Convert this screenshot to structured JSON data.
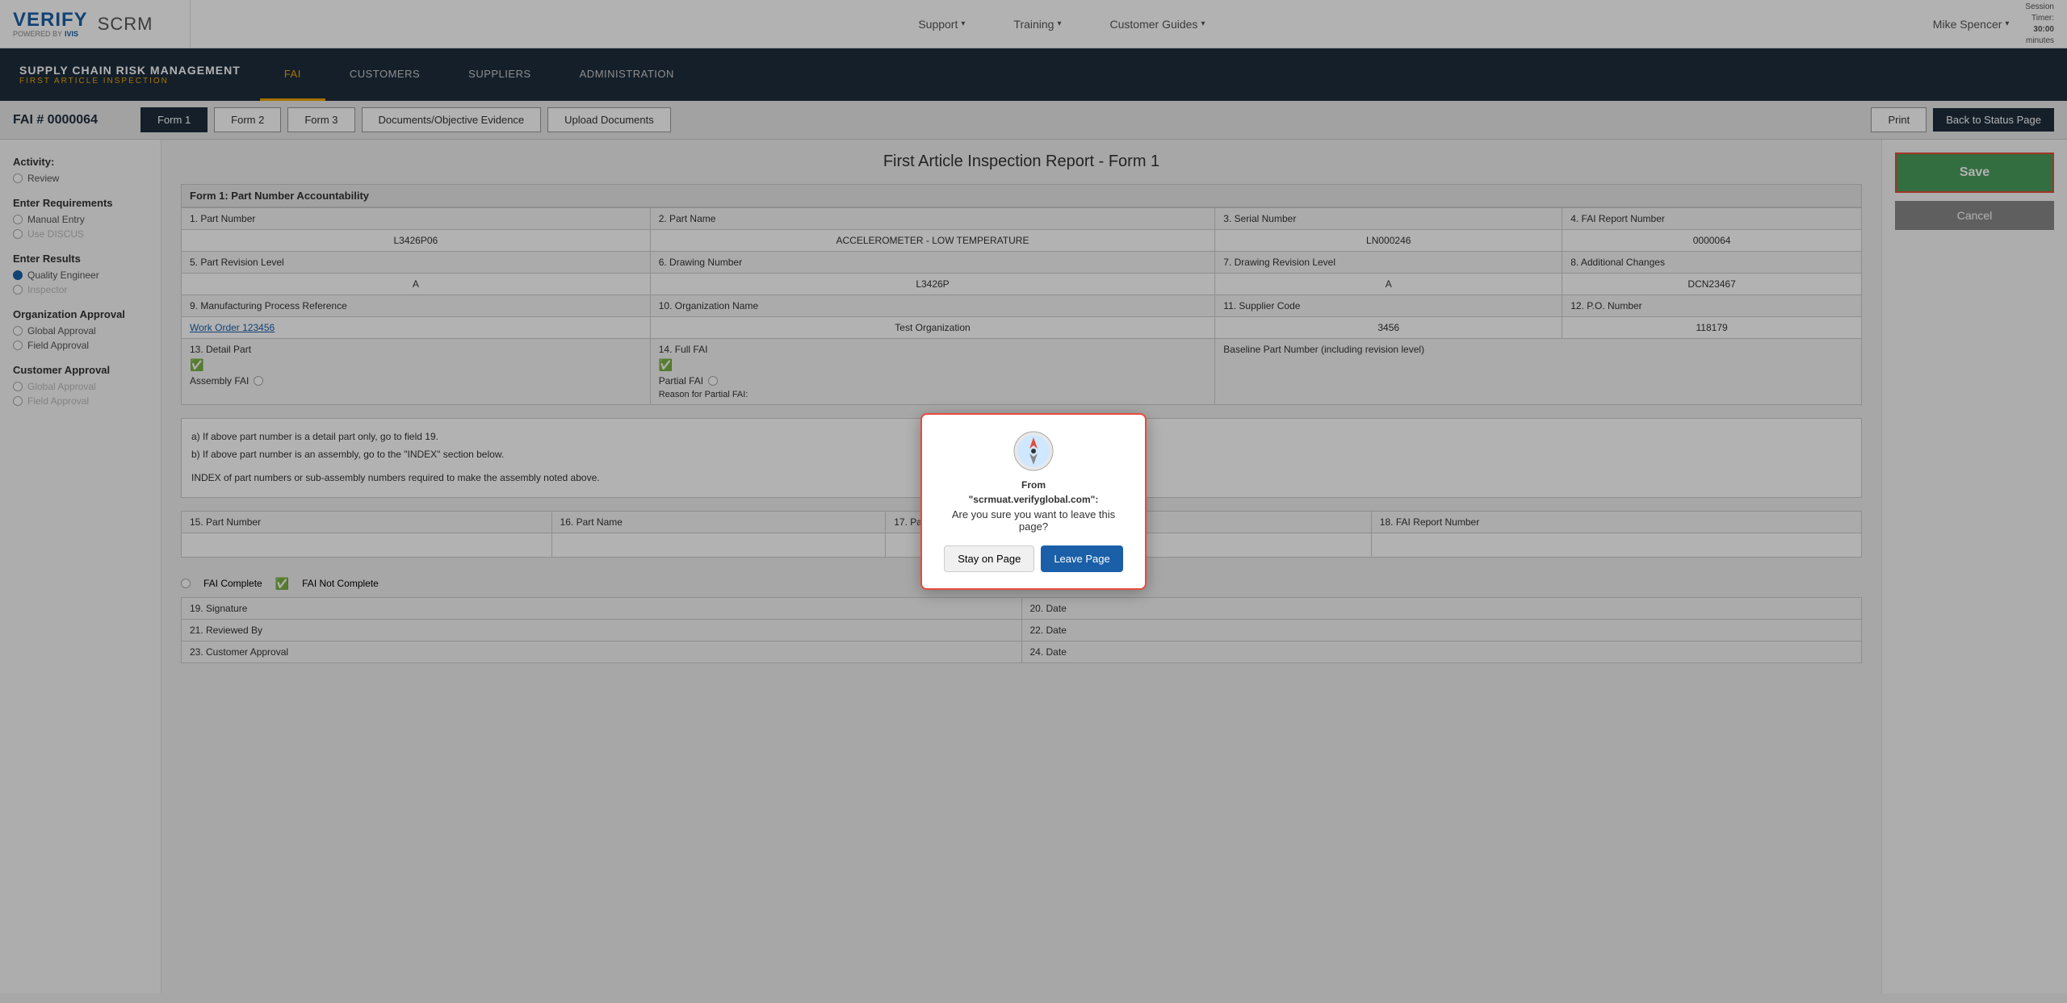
{
  "topnav": {
    "logo_verify": "VERIFY",
    "logo_powered": "POWERED BY",
    "logo_ivis": "IVIS",
    "scrm_label": "SCRM",
    "nav_links": [
      {
        "label": "Support",
        "has_arrow": true
      },
      {
        "label": "Training",
        "has_arrow": true
      },
      {
        "label": "Customer Guides",
        "has_arrow": true
      }
    ],
    "user_name": "Mike Spencer",
    "session_label": "Session",
    "session_timer": "Timer:",
    "session_time": "30:00",
    "session_minutes": "minutes"
  },
  "secondary_nav": {
    "brand_title": "SUPPLY CHAIN RISK MANAGEMENT",
    "brand_sub": "FIRST ARTICLE INSPECTION",
    "links": [
      {
        "label": "FAI",
        "active": true
      },
      {
        "label": "CUSTOMERS",
        "active": false
      },
      {
        "label": "SUPPLIERS",
        "active": false
      },
      {
        "label": "ADMINISTRATION",
        "active": false
      }
    ]
  },
  "tabbar": {
    "fai_number": "FAI # 0000064",
    "tabs": [
      {
        "label": "Form 1",
        "active": true
      },
      {
        "label": "Form 2",
        "active": false
      },
      {
        "label": "Form 3",
        "active": false
      },
      {
        "label": "Documents/Objective Evidence",
        "active": false
      },
      {
        "label": "Upload Documents",
        "active": false
      }
    ],
    "print_label": "Print",
    "back_label": "Back to Status Page"
  },
  "sidebar": {
    "activity_label": "Activity:",
    "review_label": "Review",
    "enter_requirements_label": "Enter Requirements",
    "manual_entry_label": "Manual Entry",
    "use_discus_label": "Use DISCUS",
    "enter_results_label": "Enter Results",
    "quality_engineer_label": "Quality Engineer",
    "inspector_label": "Inspector",
    "org_approval_label": "Organization Approval",
    "global_approval_label": "Global Approval",
    "field_approval_label": "Field Approval",
    "customer_approval_label": "Customer Approval",
    "cust_global_approval_label": "Global Approval",
    "cust_field_approval_label": "Field Approval"
  },
  "form": {
    "title": "First Article Inspection Report - Form 1",
    "section1_title": "Form 1: Part Number Accountability",
    "fields": [
      {
        "label": "1. Part Number",
        "value": "L3426P06"
      },
      {
        "label": "2. Part Name",
        "value": "ACCELEROMETER - LOW TEMPERATURE"
      },
      {
        "label": "3. Serial Number",
        "value": "LN000246"
      },
      {
        "label": "4. FAI Report Number",
        "value": "0000064"
      },
      {
        "label": "5. Part Revision Level",
        "value": "A"
      },
      {
        "label": "6. Drawing Number",
        "value": "L3426P"
      },
      {
        "label": "7. Drawing Revision Level",
        "value": "A"
      },
      {
        "label": "8. Additional Changes",
        "value": "DCN23467"
      },
      {
        "label": "9. Manufacturing Process Reference",
        "value": "Work Order 123456"
      },
      {
        "label": "10. Organization Name",
        "value": "Test Organization"
      },
      {
        "label": "11. Supplier Code",
        "value": "3456"
      },
      {
        "label": "12. P.O. Number",
        "value": "118179"
      }
    ],
    "detail_part_label": "13. Detail Part",
    "assembly_fai_label": "Assembly FAI",
    "full_fai_label": "14. Full FAI",
    "partial_fai_label": "Partial FAI",
    "reason_partial_label": "Reason for Partial FAI:",
    "baseline_label": "Baseline Part Number (including revision level)",
    "info_text_a": "a) If above part number is a detail part only, go to field 19.",
    "info_text_b": "b) If above part number is an assembly, go to the \"INDEX\" section below.",
    "info_text_index": "INDEX of part numbers or sub-assembly numbers required to make the assembly noted above.",
    "col15": "15. Part Number",
    "col16": "16. Part Name",
    "col17": "17. Part Serial Number",
    "col18": "18. FAI Report Number",
    "fai_complete_label": "FAI Complete",
    "fai_not_complete_label": "FAI Not Complete",
    "row19": "19. Signature",
    "row20": "20. Date",
    "row21": "21. Reviewed By",
    "row22": "22. Date",
    "row23": "23. Customer Approval",
    "row24": "24. Date"
  },
  "rightpanel": {
    "save_label": "Save",
    "cancel_label": "Cancel"
  },
  "modal": {
    "from_text": "From",
    "site_name": "\"scrmuat.verifyglobal.com\":",
    "message": "Are you sure you want to leave this page?",
    "stay_label": "Stay on Page",
    "leave_label": "Leave Page"
  }
}
